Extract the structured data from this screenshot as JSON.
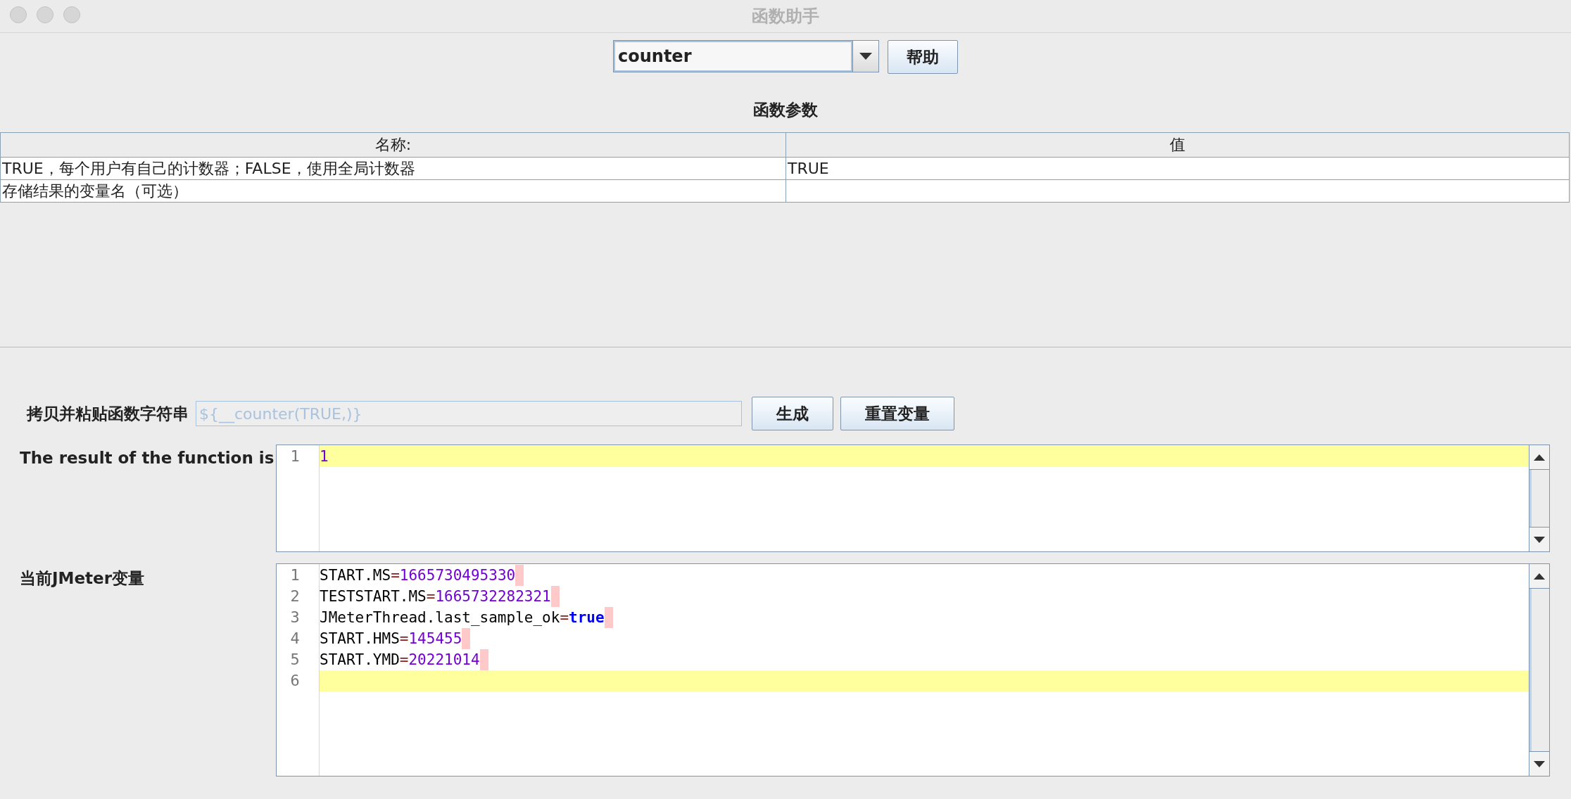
{
  "window": {
    "title": "函数助手"
  },
  "function_select": {
    "value": "counter"
  },
  "help_button": "帮助",
  "parameters": {
    "title": "函数参数",
    "columns": [
      "名称:",
      "值"
    ],
    "rows": [
      {
        "name": "TRUE，每个用户有自己的计数器；FALSE，使用全局计数器",
        "value": "TRUE"
      },
      {
        "name": "存储结果的变量名（可选）",
        "value": ""
      }
    ]
  },
  "function_string": {
    "label": "拷贝并粘贴函数字符串",
    "value": "${__counter(TRUE,)}",
    "buttons": [
      "生成",
      "重置变量"
    ]
  },
  "result": {
    "label": "The result of the function is",
    "lines": [
      {
        "number": "1",
        "value": "1",
        "kind": "number",
        "current": true
      }
    ]
  },
  "variables": {
    "label": "当前JMeter变量",
    "lines": [
      {
        "number": "1",
        "key": "START.MS",
        "separator": "=",
        "value": "1665730495330",
        "kind": "number",
        "current": false
      },
      {
        "number": "2",
        "key": "TESTSTART.MS",
        "separator": "=",
        "value": "1665732282321",
        "kind": "number",
        "current": false
      },
      {
        "number": "3",
        "key": "JMeterThread.last_sample_ok",
        "separator": "=",
        "value": "true",
        "kind": "boolean",
        "current": false
      },
      {
        "number": "4",
        "key": "START.HMS",
        "separator": "=",
        "value": "145455",
        "kind": "number",
        "current": false
      },
      {
        "number": "5",
        "key": "START.YMD",
        "separator": "=",
        "value": "20221014",
        "kind": "number",
        "current": false
      },
      {
        "number": "6",
        "current": true
      }
    ]
  }
}
